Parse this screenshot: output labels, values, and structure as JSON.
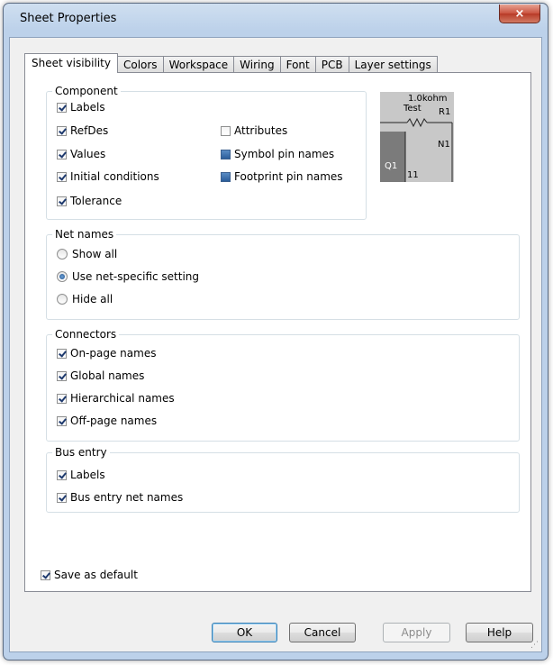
{
  "window": {
    "title": "Sheet Properties",
    "close_glyph": "×"
  },
  "tabs": [
    "Sheet visibility",
    "Colors",
    "Workspace",
    "Wiring",
    "Font",
    "PCB",
    "Layer settings"
  ],
  "component": {
    "title": "Component",
    "labels": "Labels",
    "refdes": "RefDes",
    "values": "Values",
    "initial_conditions": "Initial conditions",
    "tolerance": "Tolerance",
    "attributes": "Attributes",
    "symbol_pin_names": "Symbol pin names",
    "footprint_pin_names": "Footprint pin names"
  },
  "preview": {
    "value": "1.0kohm",
    "tolerance": "Test",
    "refdes": "R1",
    "net": "N1",
    "transistor": "Q1",
    "pin": "11"
  },
  "net_names": {
    "title": "Net names",
    "options": [
      "Show all",
      "Use net-specific setting",
      "Hide all"
    ],
    "selected": "Use net-specific setting"
  },
  "connectors": {
    "title": "Connectors",
    "on_page": "On-page names",
    "global": "Global names",
    "hierarchical": "Hierarchical names",
    "off_page": "Off-page names"
  },
  "bus_entry": {
    "title": "Bus entry",
    "labels": "Labels",
    "net_names": "Bus entry net names"
  },
  "save_default": "Save as default",
  "buttons": {
    "ok": "OK",
    "cancel": "Cancel",
    "apply": "Apply",
    "help": "Help"
  }
}
